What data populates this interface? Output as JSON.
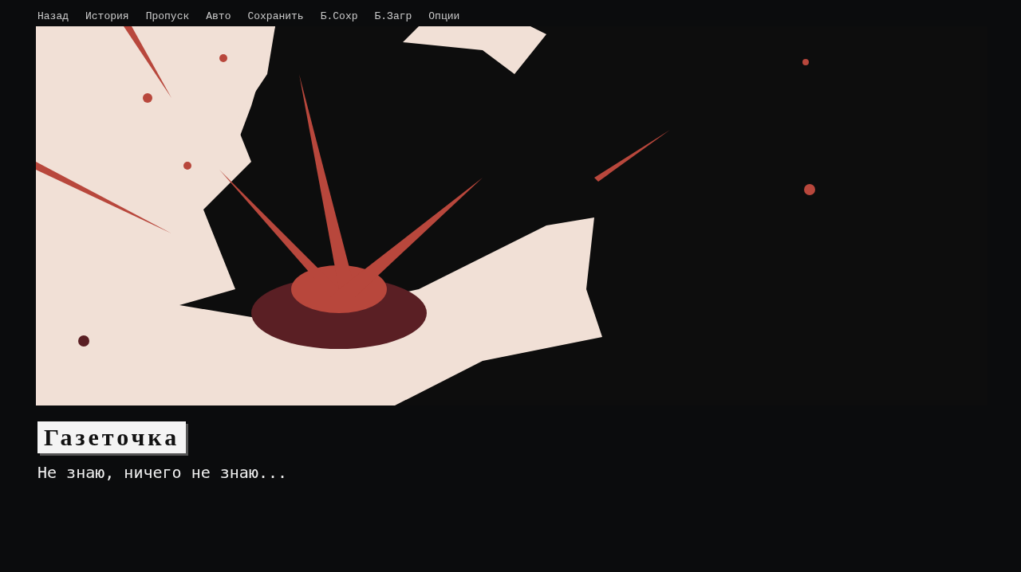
{
  "quick_menu": [
    "Назад",
    "История",
    "Пропуск",
    "Авто",
    "Сохранить",
    "Б.Сохр",
    "Б.Загр",
    "Опции"
  ],
  "dialogue": {
    "speaker": "Газеточка",
    "text": "Не знаю, ничего не знаю..."
  }
}
